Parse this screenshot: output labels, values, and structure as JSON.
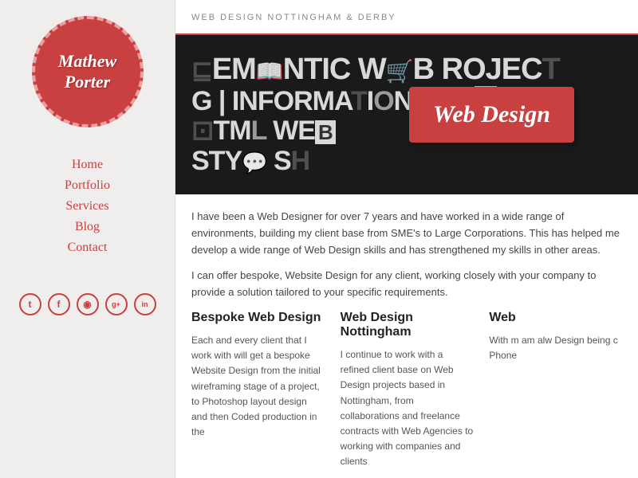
{
  "sidebar": {
    "logo_text_line1": "Mathew",
    "logo_text_line2": "Porter",
    "nav": [
      {
        "label": "Home",
        "id": "home"
      },
      {
        "label": "Portfolio",
        "id": "portfolio"
      },
      {
        "label": "Services",
        "id": "services"
      },
      {
        "label": "Blog",
        "id": "blog"
      },
      {
        "label": "Contact",
        "id": "contact"
      }
    ],
    "social": [
      {
        "icon": "T",
        "name": "twitter"
      },
      {
        "icon": "f",
        "name": "facebook"
      },
      {
        "icon": "◎",
        "name": "dribbble"
      },
      {
        "icon": "g+",
        "name": "googleplus"
      },
      {
        "icon": "in",
        "name": "linkedin"
      }
    ]
  },
  "header": {
    "tagline": "WEB DESIGN NOTTINGHAM & DERBY"
  },
  "hero": {
    "line1": "SEMANTIC W",
    "line2a": "G | INFORMAT",
    "line2b": "ION ARCH",
    "line3": "HTML  WE",
    "line4": "STY",
    "badge_text": "Web Design"
  },
  "content": {
    "intro1": "I have been a Web Designer for over 7 years and have worked in a wide range of environments, building my client base from SME's to Large Corporations. This has helped me develop a wide range of Web Design skills and has strengthened my skills in other areas.",
    "intro2": "I can offer bespoke, Website Design for any client, working closely with your company to provide a solution tailored to your specific requirements.",
    "col1_title": "Bespoke Web Design",
    "col1_text": "Each and every client that I work with will get a bespoke Website Design from the initial wireframing stage of a project, to Photoshop layout design and then Coded production in the",
    "col2_title": "Web Design Nottingham",
    "col2_text": "I continue to work with a refined client base on Web Design projects based in Nottingham, from collaborations and freelance contracts with Web Agencies to working with companies and clients",
    "col3_title": "Web",
    "col3_text": "With m am alw Design being c Phone"
  }
}
